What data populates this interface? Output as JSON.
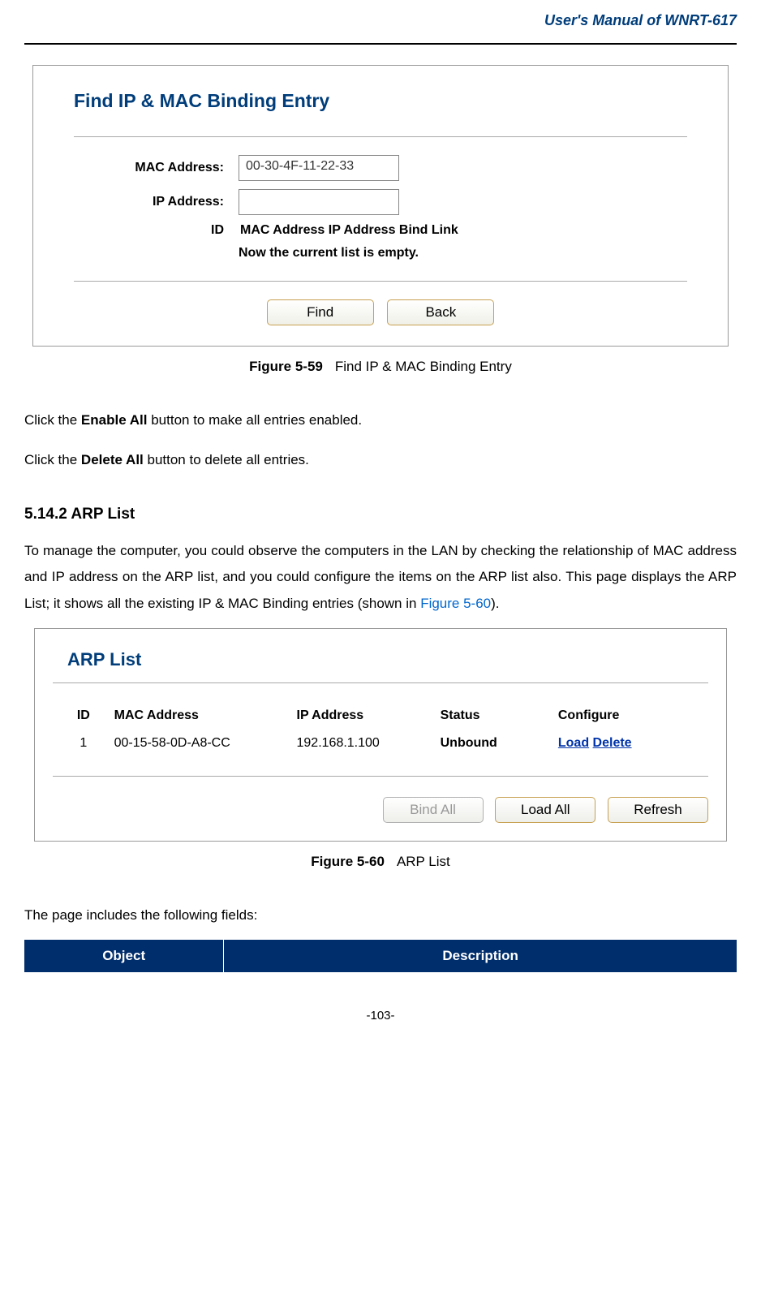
{
  "header": {
    "title": "User's Manual of WNRT-617"
  },
  "figure59": {
    "title": "Find IP & MAC Binding Entry",
    "labels": {
      "mac": "MAC Address:",
      "ip": "IP Address:",
      "id": "ID"
    },
    "values": {
      "mac": "00-30-4F-11-22-33",
      "ip": ""
    },
    "tableHeader": "MAC Address IP Address Bind Link",
    "status": "Now the current list is empty.",
    "buttons": {
      "find": "Find",
      "back": "Back"
    },
    "caption": {
      "label": "Figure 5-59",
      "text": "Find IP & MAC Binding Entry"
    }
  },
  "bodyText": {
    "p1_pre": "Click the ",
    "p1_bold": "Enable All",
    "p1_post": " button to make all entries enabled.",
    "p2_pre": "Click the ",
    "p2_bold": "Delete All",
    "p2_post": " button to delete all entries."
  },
  "section": {
    "heading": "5.14.2 ARP List",
    "paragraph_pre": "To manage the computer, you could observe the computers in the LAN by checking the relationship of MAC address and IP address on the ARP list, and you could configure the items on the ARP list also. This page displays the ARP List; it shows all the existing IP & MAC Binding entries (shown in ",
    "paragraph_link": "Figure 5-60",
    "paragraph_post": ")."
  },
  "figure60": {
    "title": "ARP List",
    "headers": {
      "id": "ID",
      "mac": "MAC Address",
      "ip": "IP Address",
      "status": "Status",
      "configure": "Configure"
    },
    "row": {
      "id": "1",
      "mac": "00-15-58-0D-A8-CC",
      "ip": "192.168.1.100",
      "status": "Unbound",
      "load": "Load",
      "delete": "Delete"
    },
    "buttons": {
      "bindAll": "Bind All",
      "loadAll": "Load All",
      "refresh": "Refresh"
    },
    "caption": {
      "label": "Figure 5-60",
      "text": "ARP List"
    }
  },
  "fieldsIntro": "The page includes the following fields:",
  "fieldsTable": {
    "object": "Object",
    "description": "Description"
  },
  "pageNumber": "-103-"
}
